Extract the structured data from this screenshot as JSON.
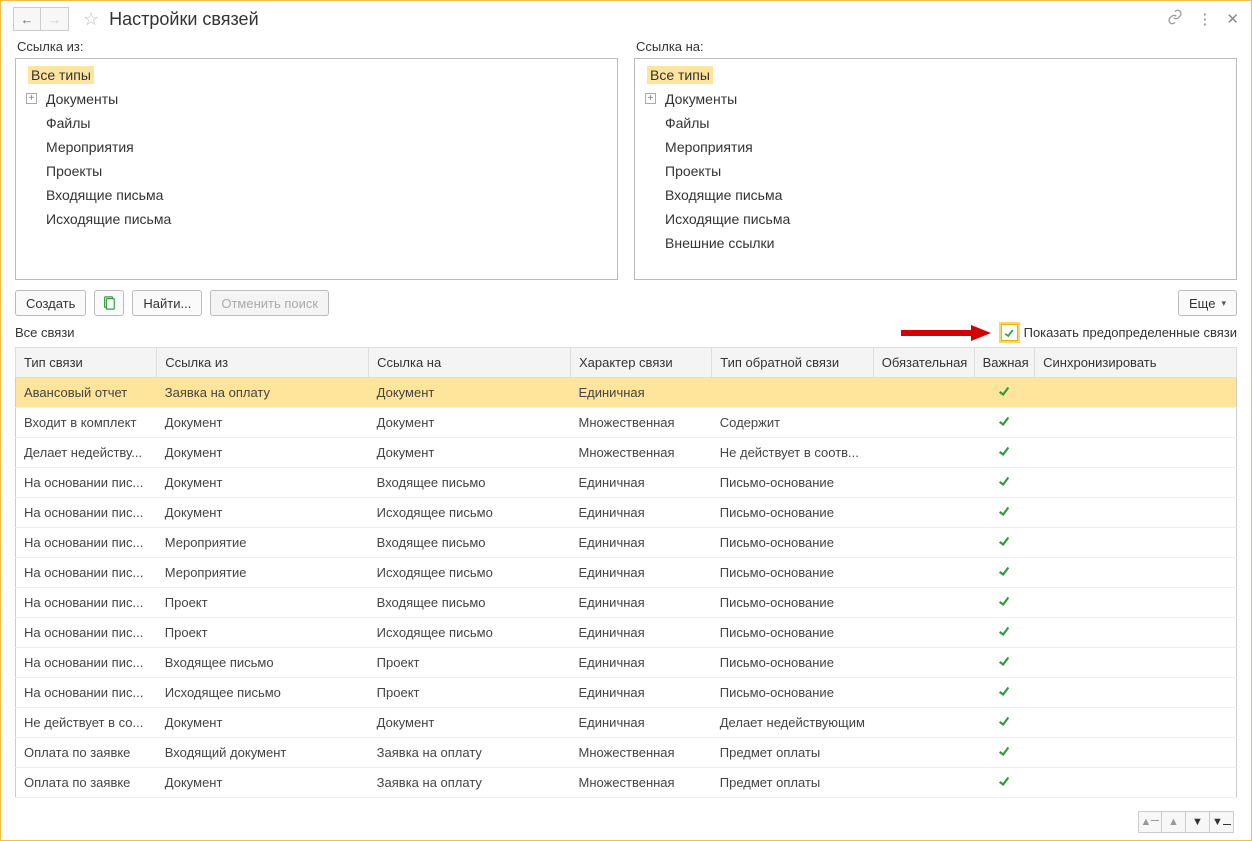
{
  "header": {
    "title": "Настройки связей"
  },
  "left_tree": {
    "label": "Ссылка из:",
    "items": [
      "Все типы",
      "Документы",
      "Файлы",
      "Мероприятия",
      "Проекты",
      "Входящие письма",
      "Исходящие письма"
    ]
  },
  "right_tree": {
    "label": "Ссылка на:",
    "items": [
      "Все типы",
      "Документы",
      "Файлы",
      "Мероприятия",
      "Проекты",
      "Входящие письма",
      "Исходящие письма",
      "Внешние ссылки"
    ]
  },
  "toolbar": {
    "create": "Создать",
    "find": "Найти...",
    "cancel_search": "Отменить поиск",
    "more": "Еще"
  },
  "sub": {
    "title": "Все связи",
    "show_predef": "Показать предопределенные связи"
  },
  "table": {
    "headers": [
      "Тип связи",
      "Ссылка из",
      "Ссылка на",
      "Характер связи",
      "Тип обратной связи",
      "Обязательная",
      "Важная",
      "Синхронизировать"
    ],
    "rows": [
      {
        "sel": true,
        "c": [
          "Авансовый отчет",
          "Заявка на оплату",
          "Документ",
          "Единичная",
          "",
          "",
          true,
          ""
        ]
      },
      {
        "sel": false,
        "c": [
          "Входит в комплект",
          "Документ",
          "Документ",
          "Множественная",
          "Содержит",
          "",
          true,
          ""
        ]
      },
      {
        "sel": false,
        "c": [
          "Делает недейству...",
          "Документ",
          "Документ",
          "Множественная",
          "Не действует в соотв...",
          "",
          true,
          ""
        ]
      },
      {
        "sel": false,
        "c": [
          "На основании пис...",
          "Документ",
          "Входящее письмо",
          "Единичная",
          "Письмо-основание",
          "",
          true,
          ""
        ]
      },
      {
        "sel": false,
        "c": [
          "На основании пис...",
          "Документ",
          "Исходящее письмо",
          "Единичная",
          "Письмо-основание",
          "",
          true,
          ""
        ]
      },
      {
        "sel": false,
        "c": [
          "На основании пис...",
          "Мероприятие",
          "Входящее письмо",
          "Единичная",
          "Письмо-основание",
          "",
          true,
          ""
        ]
      },
      {
        "sel": false,
        "c": [
          "На основании пис...",
          "Мероприятие",
          "Исходящее письмо",
          "Единичная",
          "Письмо-основание",
          "",
          true,
          ""
        ]
      },
      {
        "sel": false,
        "c": [
          "На основании пис...",
          "Проект",
          "Входящее письмо",
          "Единичная",
          "Письмо-основание",
          "",
          true,
          ""
        ]
      },
      {
        "sel": false,
        "c": [
          "На основании пис...",
          "Проект",
          "Исходящее письмо",
          "Единичная",
          "Письмо-основание",
          "",
          true,
          ""
        ]
      },
      {
        "sel": false,
        "c": [
          "На основании пис...",
          "Входящее письмо",
          "Проект",
          "Единичная",
          "Письмо-основание",
          "",
          true,
          ""
        ]
      },
      {
        "sel": false,
        "c": [
          "На основании пис...",
          "Исходящее письмо",
          "Проект",
          "Единичная",
          "Письмо-основание",
          "",
          true,
          ""
        ]
      },
      {
        "sel": false,
        "c": [
          "Не действует в со...",
          "Документ",
          "Документ",
          "Единичная",
          "Делает недействующим",
          "",
          true,
          ""
        ]
      },
      {
        "sel": false,
        "c": [
          "Оплата по заявке",
          "Входящий документ",
          "Заявка на оплату",
          "Множественная",
          "Предмет оплаты",
          "",
          true,
          ""
        ]
      },
      {
        "sel": false,
        "c": [
          "Оплата по заявке",
          "Документ",
          "Заявка на оплату",
          "Множественная",
          "Предмет оплаты",
          "",
          true,
          ""
        ]
      }
    ]
  }
}
